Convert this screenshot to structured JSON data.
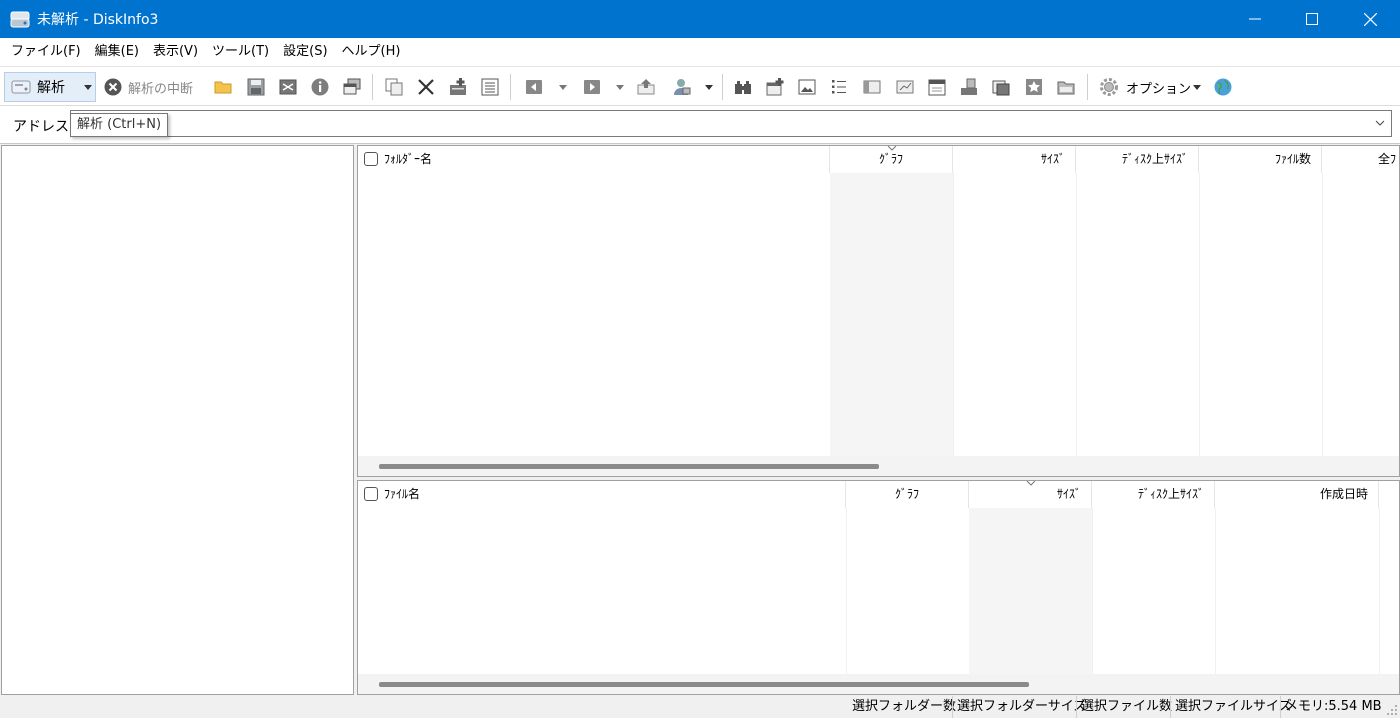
{
  "window": {
    "title": "未解析 - DiskInfo3",
    "icon": "disk-icon",
    "minimize_glyph": "—",
    "maximize_glyph": "☐",
    "close_glyph": "✕"
  },
  "menu": [
    "ファイル(F)",
    "編集(E)",
    "表示(V)",
    "ツール(T)",
    "設定(S)",
    "ヘルプ(H)"
  ],
  "toolbar": {
    "analyze_label": "解析",
    "stop_label": "解析の中断",
    "options_label": "オプション"
  },
  "address": {
    "label": "アドレス",
    "value": "",
    "tooltip": "解析 (Ctrl+N)"
  },
  "folder_list": {
    "columns": [
      "ﾌｫﾙﾀﾞｰ名",
      "ｸﾞﾗﾌ",
      "ｻｲｽﾞ",
      "ﾃﾞｨｽｸ上ｻｲｽﾞ",
      "ﾌｧｲﾙ数",
      "全ﾌ"
    ],
    "rows": []
  },
  "file_list": {
    "columns": [
      "ﾌｧｲﾙ名",
      "ｸﾞﾗﾌ",
      "ｻｲｽﾞ",
      "ﾃﾞｨｽｸ上ｻｲｽﾞ",
      "作成日時"
    ],
    "rows": []
  },
  "status": {
    "selected_folders": "選択フォルダー数",
    "selected_folder_size": "選択フォルダーサイズ",
    "selected_files": "選択ファイル数",
    "selected_file_size": "選択ファイルサイズ",
    "memory": "メモリ:5.54 MB"
  },
  "colors": {
    "titlebar": "#0073cf",
    "analyze_button_bg": "#e3eef9",
    "sorted_column_bg": "#f5f5f5"
  }
}
